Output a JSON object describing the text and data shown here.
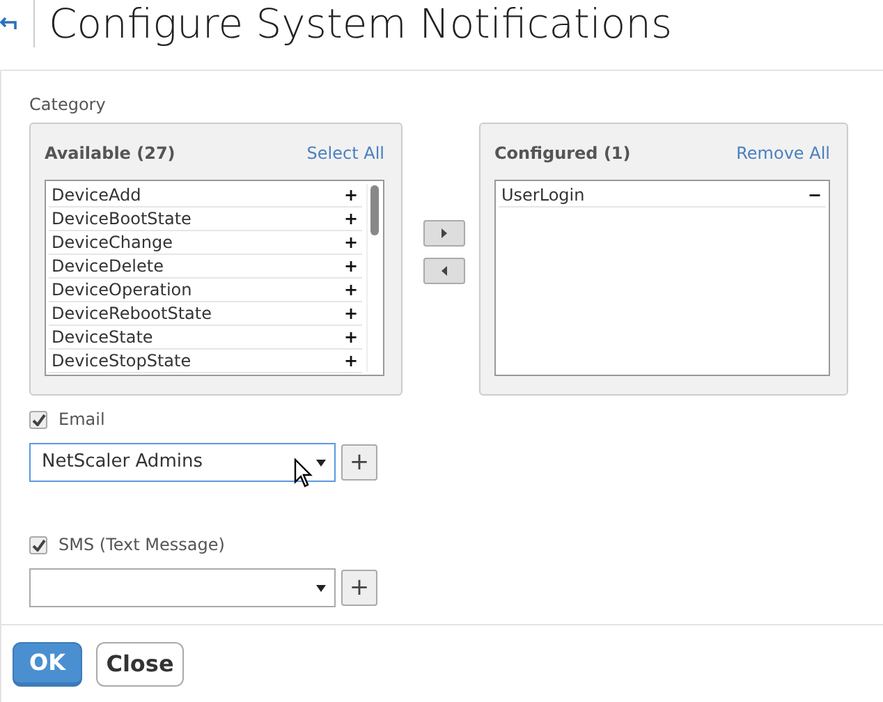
{
  "title": "Configure System Notifications",
  "category_label": "Category",
  "available": {
    "heading": "Available (27)",
    "action": "Select All",
    "items": [
      {
        "label": "DeviceAdd",
        "icon": "+"
      },
      {
        "label": "DeviceBootState",
        "icon": "+"
      },
      {
        "label": "DeviceChange",
        "icon": "+"
      },
      {
        "label": "DeviceDelete",
        "icon": "+"
      },
      {
        "label": "DeviceOperation",
        "icon": "+"
      },
      {
        "label": "DeviceRebootState",
        "icon": "+"
      },
      {
        "label": "DeviceState",
        "icon": "+"
      },
      {
        "label": "DeviceStopState",
        "icon": "+"
      }
    ]
  },
  "configured": {
    "heading": "Configured (1)",
    "action": "Remove All",
    "items": [
      {
        "label": "UserLogin",
        "icon": "−"
      }
    ]
  },
  "channels": [
    {
      "label": "Email",
      "checked": true,
      "value": "NetScaler Admins",
      "focused": true,
      "add_button": "+"
    },
    {
      "label": "SMS (Text Message)",
      "checked": true,
      "focused": false,
      "add_button": "+"
    }
  ],
  "buttons": [
    {
      "label": "OK",
      "kind": "primary"
    },
    {
      "label": "Close",
      "kind": "secondary"
    }
  ]
}
